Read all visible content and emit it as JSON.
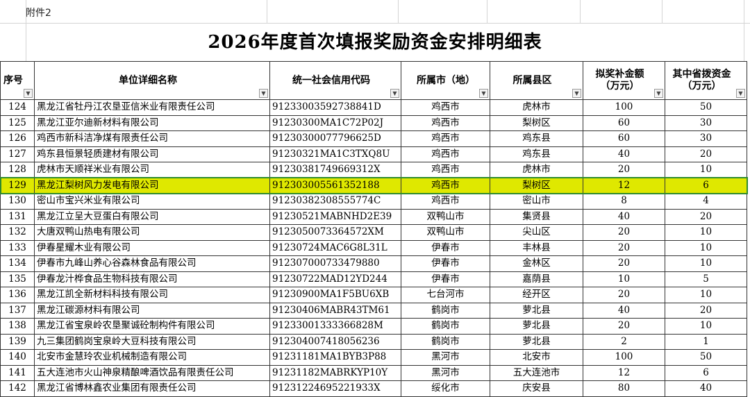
{
  "attachment_label": "附件2",
  "title": "2026年度首次填报奖励资金安排明细表",
  "headers": {
    "seq": "序号",
    "name": "单位详细名称",
    "code": "统一社会信用代码",
    "city": "所属市（地）",
    "county": "所属县区",
    "award": "拟奖补金额（万元）",
    "provincial": "其中省拨资金（万元）"
  },
  "filter_icon": "dropdown-arrow",
  "colors": {
    "highlight_fill": "#dfe800",
    "highlight_border": "#2e8b2e"
  },
  "highlighted_row": 5,
  "rows": [
    {
      "seq": "124",
      "name": "黑龙江省牡丹江农垦亚信米业有限责任公司",
      "code": "91233003592738841D",
      "city": "鸡西市",
      "county": "虎林市",
      "award": "100",
      "provincial": "50"
    },
    {
      "seq": "125",
      "name": "黑龙江亚尔迪新材料有限公司",
      "code": "91230300MA1C72P02J",
      "city": "鸡西市",
      "county": "梨树区",
      "award": "60",
      "provincial": "30"
    },
    {
      "seq": "126",
      "name": "鸡西市新科洁净煤有限责任公司",
      "code": "91230300077796625D",
      "city": "鸡西市",
      "county": "鸡东县",
      "award": "60",
      "provincial": "30"
    },
    {
      "seq": "127",
      "name": "鸡东县恒景轻质建材有限公司",
      "code": "91230321MA1C3TXQ8U",
      "city": "鸡西市",
      "county": "鸡东县",
      "award": "40",
      "provincial": "20"
    },
    {
      "seq": "128",
      "name": "虎林市天顺祥米业有限公司",
      "code": "91230381749669312X",
      "city": "鸡西市",
      "county": "虎林市",
      "award": "20",
      "provincial": "10"
    },
    {
      "seq": "129",
      "name": "黑龙江梨树风力发电有限公司",
      "code": "912303005561352188",
      "city": "鸡西市",
      "county": "梨树区",
      "award": "12",
      "provincial": "6"
    },
    {
      "seq": "130",
      "name": "密山市宝兴米业有限公司",
      "code": "91230382308555774C",
      "city": "鸡西市",
      "county": "密山市",
      "award": "8",
      "provincial": "4"
    },
    {
      "seq": "131",
      "name": "黑龙江立呈大豆蛋白有限公司",
      "code": "91230521MABNHD2E39",
      "city": "双鸭山市",
      "county": "集贤县",
      "award": "40",
      "provincial": "20"
    },
    {
      "seq": "132",
      "name": "大唐双鸭山热电有限公司",
      "code": "9123050073364572XM",
      "city": "双鸭山市",
      "county": "尖山区",
      "award": "20",
      "provincial": "10"
    },
    {
      "seq": "133",
      "name": "伊春星耀木业有限公司",
      "code": "91230724MAC6G8L31L",
      "city": "伊春市",
      "county": "丰林县",
      "award": "20",
      "provincial": "10"
    },
    {
      "seq": "134",
      "name": "伊春市九峰山养心谷森林食品有限公司",
      "code": "912307000733479880",
      "city": "伊春市",
      "county": "金林区",
      "award": "20",
      "provincial": "10"
    },
    {
      "seq": "135",
      "name": "伊春龙汁桦食品生物科技有限公司",
      "code": "91230722MAD12YD244",
      "city": "伊春市",
      "county": "嘉荫县",
      "award": "10",
      "provincial": "5"
    },
    {
      "seq": "136",
      "name": "黑龙江凯全新材料科技有限公司",
      "code": "91230900MA1F5BU6XB",
      "city": "七台河市",
      "county": "经开区",
      "award": "20",
      "provincial": "10"
    },
    {
      "seq": "137",
      "name": "黑龙江碳源材料有限公司",
      "code": "91230406MABR43TM61",
      "city": "鹤岗市",
      "county": "萝北县",
      "award": "40",
      "provincial": "20"
    },
    {
      "seq": "138",
      "name": "黑龙江省宝泉岭农垦聚诚砼制构件有限公司",
      "code": "91233001333366828M",
      "city": "鹤岗市",
      "county": "萝北县",
      "award": "20",
      "provincial": "10"
    },
    {
      "seq": "139",
      "name": "九三集团鹤岗宝泉岭大豆科技有限公司",
      "code": "912304007418056236",
      "city": "鹤岗市",
      "county": "萝北县",
      "award": "2",
      "provincial": "1"
    },
    {
      "seq": "140",
      "name": "北安市金慧玲农业机械制造有限公司",
      "code": "91231181MA1BYB3P88",
      "city": "黑河市",
      "county": "北安市",
      "award": "100",
      "provincial": "50"
    },
    {
      "seq": "141",
      "name": "五大连池市火山神泉精酿啤酒饮品有限责任公司",
      "code": "91231182MABRKYP10Y",
      "city": "黑河市",
      "county": "五大连池市",
      "award": "12",
      "provincial": "6"
    },
    {
      "seq": "142",
      "name": "黑龙江省博林鑫农业集团有限责任公司",
      "code": "91231224695221933X",
      "city": "绥化市",
      "county": "庆安县",
      "award": "80",
      "provincial": "40"
    }
  ]
}
